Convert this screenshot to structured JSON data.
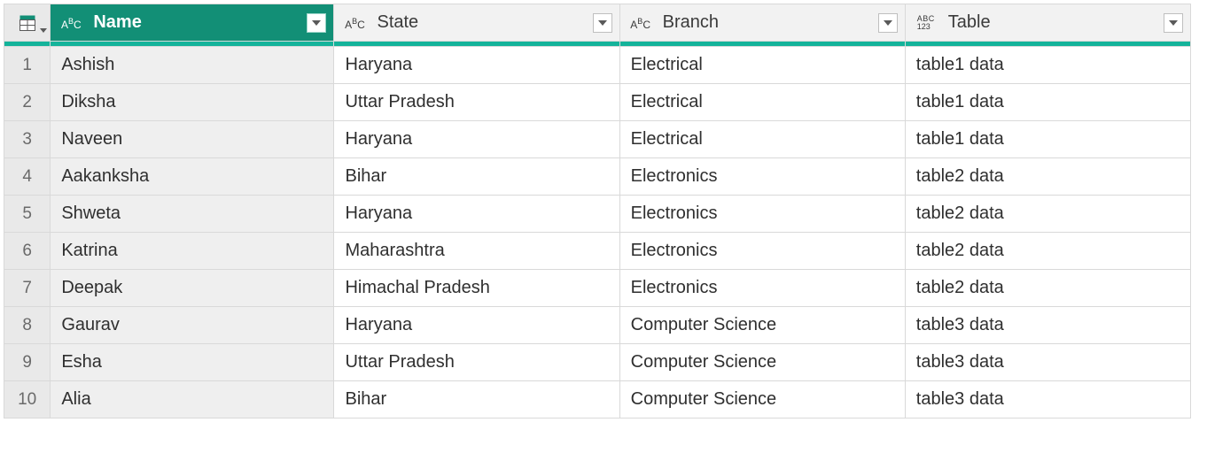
{
  "columns": {
    "name": {
      "label": "Name",
      "type": "text",
      "selected": true
    },
    "state": {
      "label": "State",
      "type": "text",
      "selected": false
    },
    "branch": {
      "label": "Branch",
      "type": "text",
      "selected": false
    },
    "table": {
      "label": "Table",
      "type": "any",
      "selected": false
    }
  },
  "rows": [
    {
      "n": "1",
      "name": "Ashish",
      "state": "Haryana",
      "branch": "Electrical",
      "table": "table1 data"
    },
    {
      "n": "2",
      "name": "Diksha",
      "state": "Uttar Pradesh",
      "branch": "Electrical",
      "table": "table1 data"
    },
    {
      "n": "3",
      "name": "Naveen",
      "state": "Haryana",
      "branch": "Electrical",
      "table": "table1 data"
    },
    {
      "n": "4",
      "name": "Aakanksha",
      "state": "Bihar",
      "branch": "Electronics",
      "table": "table2 data"
    },
    {
      "n": "5",
      "name": "Shweta",
      "state": "Haryana",
      "branch": "Electronics",
      "table": "table2 data"
    },
    {
      "n": "6",
      "name": "Katrina",
      "state": "Maharashtra",
      "branch": "Electronics",
      "table": "table2 data"
    },
    {
      "n": "7",
      "name": "Deepak",
      "state": "Himachal Pradesh",
      "branch": "Electronics",
      "table": "table2 data"
    },
    {
      "n": "8",
      "name": "Gaurav",
      "state": "Haryana",
      "branch": "Computer Science",
      "table": "table3 data"
    },
    {
      "n": "9",
      "name": "Esha",
      "state": "Uttar Pradesh",
      "branch": "Computer Science",
      "table": "table3 data"
    },
    {
      "n": "10",
      "name": "Alia",
      "state": "Bihar",
      "branch": "Computer Science",
      "table": "table3 data"
    }
  ],
  "colors": {
    "accent": "#128f76",
    "accent_light": "#14b39a",
    "row_header_bg": "#e9e9e9",
    "name_col_bg": "#efefef"
  }
}
